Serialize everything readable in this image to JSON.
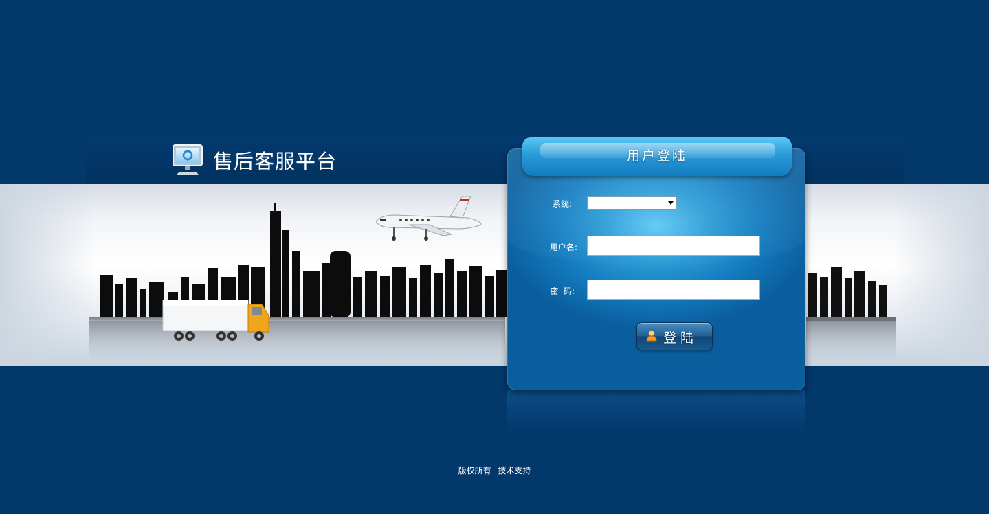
{
  "app": {
    "title": "售后客服平台"
  },
  "login": {
    "title": "用户登陆",
    "system_label": "系统:",
    "system_value": "",
    "username_label": "用户名:",
    "username_value": "",
    "password_label": "密  码:",
    "password_value": "",
    "submit_label": "登陆"
  },
  "footer": {
    "copyright": "版权所有",
    "support": "技术支持"
  },
  "colors": {
    "background": "#03386b",
    "panel_accent": "#2c9bd6",
    "text": "#ffffff"
  },
  "icons": {
    "logo": "monitor-refresh-icon",
    "button": "user-icon"
  }
}
